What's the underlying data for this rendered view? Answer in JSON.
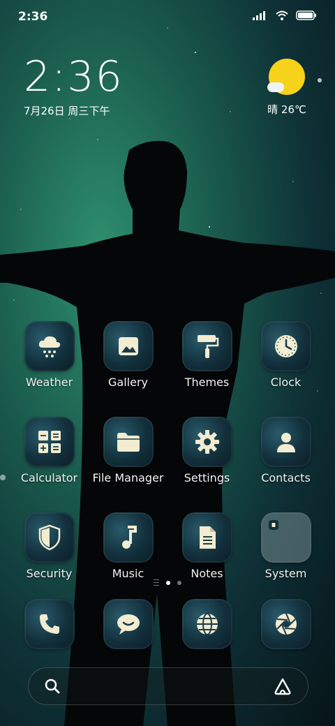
{
  "status_bar": {
    "time": "2:36"
  },
  "clock_widget": {
    "time": "2:36",
    "date": "7月26日 周三下午"
  },
  "weather_widget": {
    "text": "晴 26℃",
    "icon": "sunny-cloud-icon"
  },
  "apps": [
    {
      "label": "Weather",
      "icon": "snow-cloud-icon"
    },
    {
      "label": "Gallery",
      "icon": "image-icon"
    },
    {
      "label": "Themes",
      "icon": "paint-roller-icon"
    },
    {
      "label": "Clock",
      "icon": "clock-icon"
    },
    {
      "label": "Calculator",
      "icon": "calculator-icon"
    },
    {
      "label": "File Manager",
      "icon": "folder-icon"
    },
    {
      "label": "Settings",
      "icon": "gear-icon"
    },
    {
      "label": "Contacts",
      "icon": "person-icon"
    },
    {
      "label": "Security",
      "icon": "shield-icon"
    },
    {
      "label": "Music",
      "icon": "music-note-icon"
    },
    {
      "label": "Notes",
      "icon": "document-icon"
    },
    {
      "label": "System",
      "icon": "folder-group-icon"
    }
  ],
  "page_indicator": {
    "pages": 2,
    "active": 1
  },
  "dock": [
    {
      "name": "phone",
      "icon": "phone-icon"
    },
    {
      "name": "messages",
      "icon": "chat-bubble-icon"
    },
    {
      "name": "browser",
      "icon": "globe-icon"
    },
    {
      "name": "camera",
      "icon": "aperture-icon"
    }
  ],
  "search_bar": {
    "left_icon": "search-icon",
    "right_icon": "assistant-icon"
  },
  "colors": {
    "sun": "#f7d21a",
    "icon_glyph": "#f1ecd2",
    "background": "#1a5a4c"
  }
}
